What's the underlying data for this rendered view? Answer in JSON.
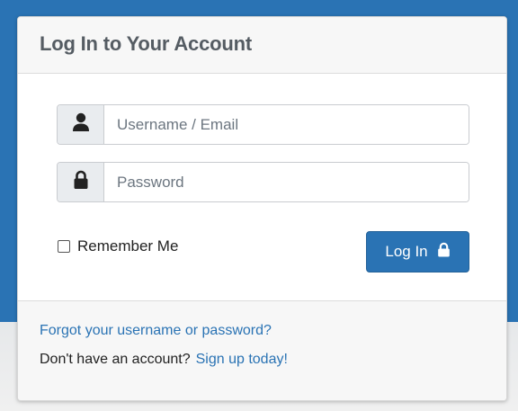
{
  "form": {
    "title": "Log In to Your Account",
    "username": {
      "placeholder": "Username / Email",
      "value": "",
      "icon": "user-icon"
    },
    "password": {
      "placeholder": "Password",
      "value": "",
      "icon": "lock-icon"
    },
    "remember": {
      "label": "Remember Me",
      "checked": false
    },
    "submit": {
      "label": "Log In",
      "icon": "lock-icon"
    }
  },
  "footer": {
    "forgot_label": "Forgot your username or password?",
    "signup_prompt": "Don't have an account?",
    "signup_label": "Sign up today!"
  },
  "colors": {
    "accent": "#2a73b4",
    "title_text": "#555c63",
    "addon_bg": "#e9ecef"
  }
}
